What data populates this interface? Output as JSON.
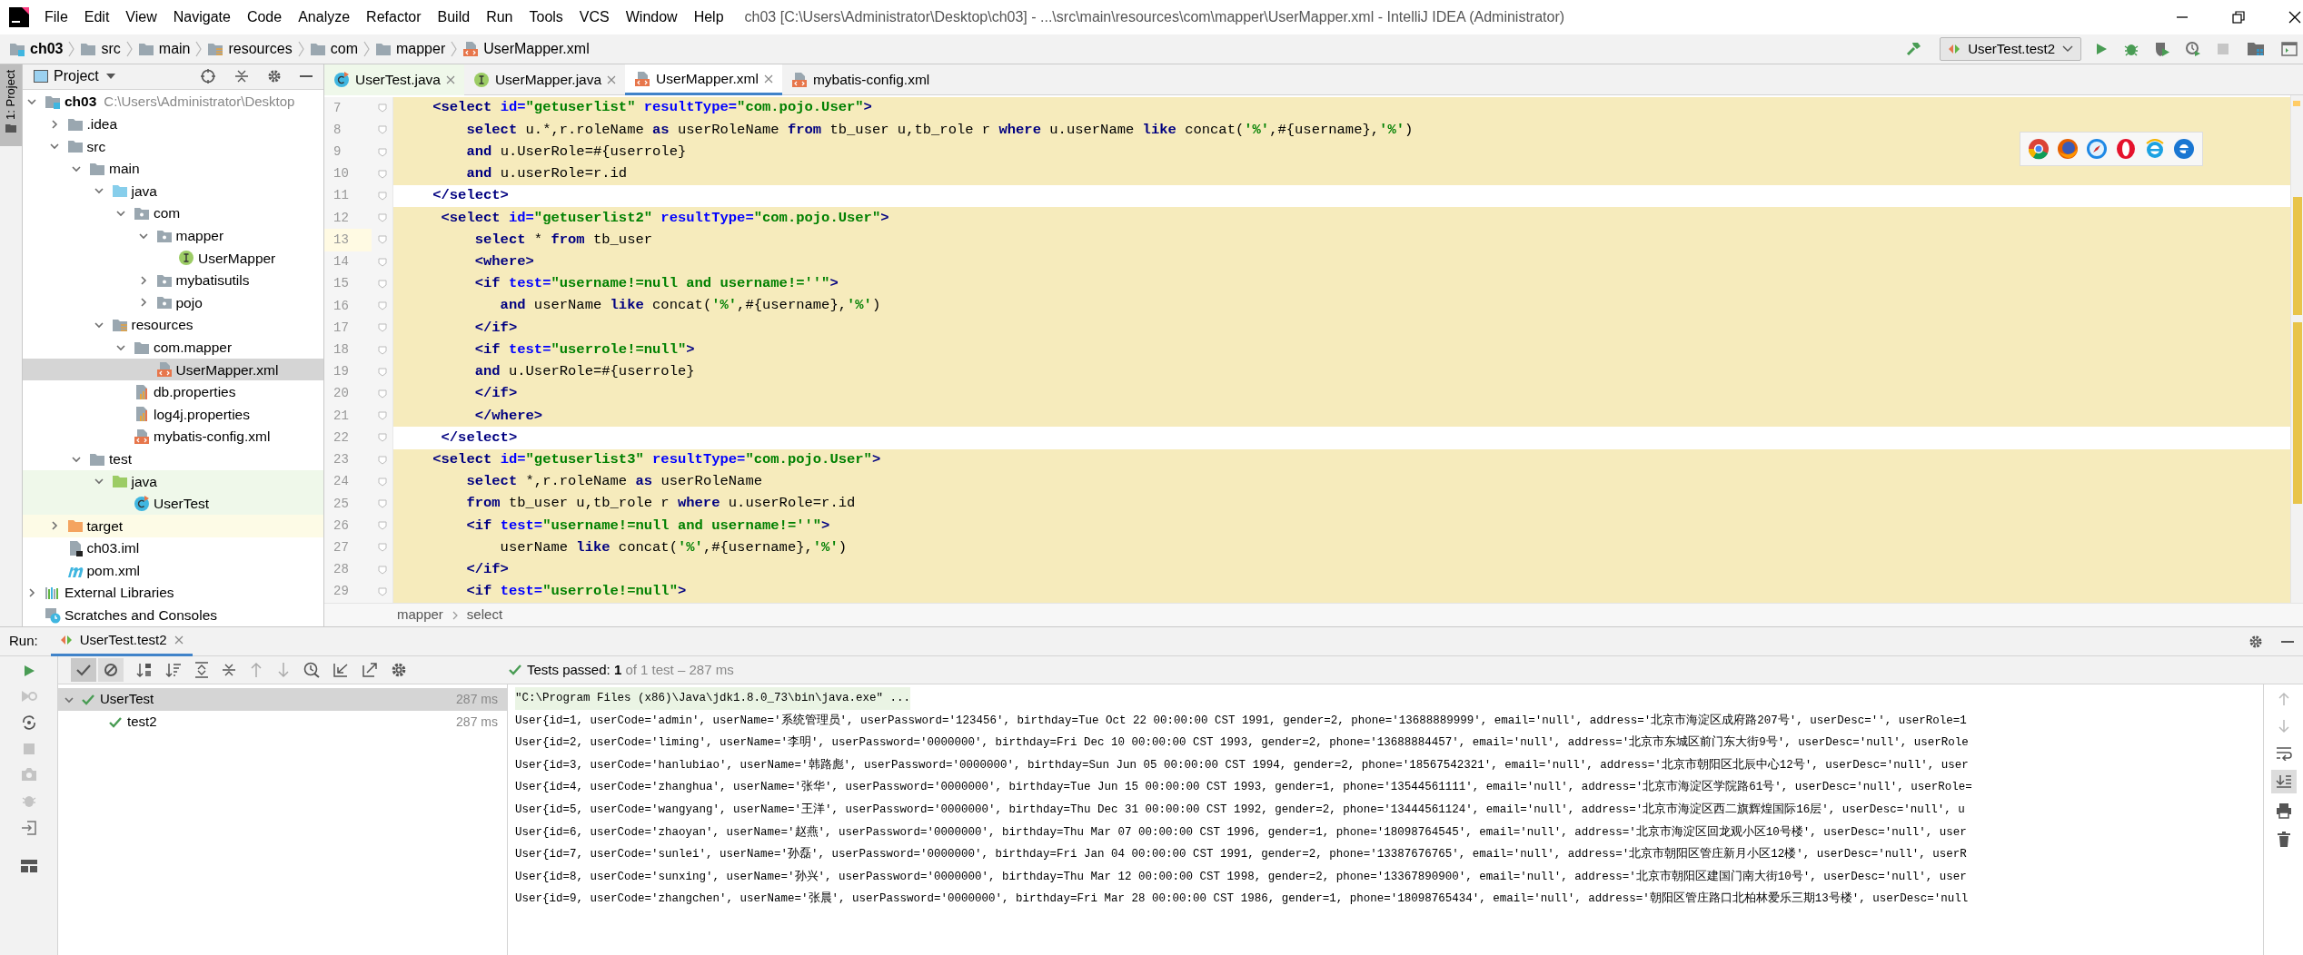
{
  "title_bar": {
    "menu": [
      "File",
      "Edit",
      "View",
      "Navigate",
      "Code",
      "Analyze",
      "Refactor",
      "Build",
      "Run",
      "Tools",
      "VCS",
      "Window",
      "Help"
    ],
    "title": "ch03 [C:\\Users\\Administrator\\Desktop\\ch03] - ...\\src\\main\\resources\\com\\mapper\\UserMapper.xml - IntelliJ IDEA (Administrator)"
  },
  "nav_bar": {
    "crumbs": [
      {
        "label": "ch03",
        "kind": "module"
      },
      {
        "label": "src",
        "kind": "folder"
      },
      {
        "label": "main",
        "kind": "folder"
      },
      {
        "label": "resources",
        "kind": "resources-folder"
      },
      {
        "label": "com",
        "kind": "folder"
      },
      {
        "label": "mapper",
        "kind": "folder"
      },
      {
        "label": "UserMapper.xml",
        "kind": "xml"
      }
    ],
    "run_config": "UserTest.test2"
  },
  "side_strip": {
    "label": "1: Project"
  },
  "project": {
    "title": "Project",
    "tree": [
      {
        "label": "ch03",
        "path_hint": "C:\\Users\\Administrator\\Desktop",
        "kind": "module",
        "expanded": true,
        "selected": false,
        "children": [
          {
            "label": ".idea",
            "kind": "folder",
            "expanded": false,
            "selected": false
          },
          {
            "label": "src",
            "kind": "folder",
            "expanded": true,
            "selected": false,
            "children": [
              {
                "label": "main",
                "kind": "folder",
                "expanded": true,
                "selected": false,
                "children": [
                  {
                    "label": "java",
                    "kind": "source-folder",
                    "expanded": true,
                    "selected": false,
                    "children": [
                      {
                        "label": "com",
                        "kind": "package",
                        "expanded": true,
                        "selected": false,
                        "children": [
                          {
                            "label": "mapper",
                            "kind": "package",
                            "expanded": true,
                            "selected": false,
                            "children": [
                              {
                                "label": "UserMapper",
                                "kind": "interface",
                                "selected": false
                              }
                            ]
                          },
                          {
                            "label": "mybatisutils",
                            "kind": "package",
                            "expanded": false,
                            "selected": false
                          },
                          {
                            "label": "pojo",
                            "kind": "package",
                            "expanded": false,
                            "selected": false
                          }
                        ]
                      }
                    ]
                  },
                  {
                    "label": "resources",
                    "kind": "resources-folder",
                    "expanded": true,
                    "selected": false,
                    "children": [
                      {
                        "label": "com.mapper",
                        "kind": "folder",
                        "expanded": true,
                        "selected": false,
                        "children": [
                          {
                            "label": "UserMapper.xml",
                            "kind": "xml",
                            "selected": true
                          }
                        ]
                      },
                      {
                        "label": "db.properties",
                        "kind": "properties",
                        "selected": false
                      },
                      {
                        "label": "log4j.properties",
                        "kind": "properties",
                        "selected": false
                      },
                      {
                        "label": "mybatis-config.xml",
                        "kind": "xml",
                        "selected": false
                      }
                    ]
                  }
                ]
              },
              {
                "label": "test",
                "kind": "folder",
                "expanded": true,
                "selected": false,
                "children": [
                  {
                    "label": "java",
                    "kind": "test-folder",
                    "expanded": true,
                    "selected": false,
                    "children": [
                      {
                        "label": "UserTest",
                        "kind": "test-class",
                        "selected": false
                      }
                    ]
                  }
                ]
              }
            ]
          },
          {
            "label": "target",
            "kind": "excluded-folder",
            "expanded": false,
            "selected": false
          },
          {
            "label": "ch03.iml",
            "kind": "iml",
            "selected": false
          },
          {
            "label": "pom.xml",
            "kind": "maven",
            "selected": false
          }
        ]
      },
      {
        "label": "External Libraries",
        "kind": "libraries",
        "expanded": false,
        "selected": false
      },
      {
        "label": "Scratches and Consoles",
        "kind": "scratches",
        "selected": false
      }
    ]
  },
  "editor": {
    "tabs": [
      {
        "label": "UserTest.java",
        "kind": "test-class",
        "selected": false,
        "closable": true
      },
      {
        "label": "UserMapper.java",
        "kind": "interface",
        "selected": false,
        "closable": true
      },
      {
        "label": "UserMapper.xml",
        "kind": "xml",
        "selected": true,
        "closable": true
      },
      {
        "label": "mybatis-config.xml",
        "kind": "xml",
        "selected": false,
        "closable": false
      }
    ],
    "lines": [
      {
        "n": "7",
        "injected": true,
        "current": false,
        "tokens": [
          {
            "kind": "tag",
            "text": "    <select "
          },
          {
            "kind": "attribute",
            "text": "id="
          },
          {
            "kind": "value",
            "text": "\"getuserlist\""
          },
          {
            "kind": "attribute",
            "text": " resultType="
          },
          {
            "kind": "value",
            "text": "\"com.pojo.User\""
          },
          {
            "kind": "tag",
            "text": ">"
          }
        ]
      },
      {
        "n": "8",
        "injected": true,
        "current": false,
        "tokens": [
          {
            "kind": "keyword",
            "text": "        select"
          },
          {
            "kind": "plain",
            "text": " u.*,r.roleName "
          },
          {
            "kind": "keyword",
            "text": "as"
          },
          {
            "kind": "plain",
            "text": " userRoleName "
          },
          {
            "kind": "keyword",
            "text": "from"
          },
          {
            "kind": "plain",
            "text": " tb_user u,tb_role r "
          },
          {
            "kind": "keyword",
            "text": "where"
          },
          {
            "kind": "plain",
            "text": " u.userName "
          },
          {
            "kind": "keyword",
            "text": "like"
          },
          {
            "kind": "plain",
            "text": " concat("
          },
          {
            "kind": "string",
            "text": "'%'"
          },
          {
            "kind": "plain",
            "text": ",#{username},"
          },
          {
            "kind": "string",
            "text": "'%'"
          },
          {
            "kind": "plain",
            "text": ")"
          }
        ]
      },
      {
        "n": "9",
        "injected": true,
        "current": false,
        "tokens": [
          {
            "kind": "keyword",
            "text": "        and"
          },
          {
            "kind": "plain",
            "text": " u.UserRole=#{userrole}"
          }
        ]
      },
      {
        "n": "10",
        "injected": true,
        "current": false,
        "tokens": [
          {
            "kind": "keyword",
            "text": "        and"
          },
          {
            "kind": "plain",
            "text": " u.userRole=r.id"
          }
        ]
      },
      {
        "n": "11",
        "injected": false,
        "current": false,
        "tokens": [
          {
            "kind": "tag",
            "text": "    </select>"
          }
        ]
      },
      {
        "n": "12",
        "injected": true,
        "current": false,
        "tokens": [
          {
            "kind": "tag",
            "text": "     <select "
          },
          {
            "kind": "attribute",
            "text": "id="
          },
          {
            "kind": "value",
            "text": "\"getuserlist2\""
          },
          {
            "kind": "attribute",
            "text": " resultType="
          },
          {
            "kind": "value",
            "text": "\"com.pojo.User\""
          },
          {
            "kind": "tag",
            "text": ">"
          }
        ]
      },
      {
        "n": "13",
        "injected": true,
        "current": true,
        "tokens": [
          {
            "kind": "keyword",
            "text": "         select"
          },
          {
            "kind": "plain",
            "text": " * "
          },
          {
            "kind": "keyword",
            "text": "from"
          },
          {
            "kind": "plain",
            "text": " tb_user"
          }
        ]
      },
      {
        "n": "14",
        "injected": true,
        "current": false,
        "tokens": [
          {
            "kind": "tag",
            "text": "         <where>"
          }
        ]
      },
      {
        "n": "15",
        "injected": true,
        "current": false,
        "tokens": [
          {
            "kind": "tag",
            "text": "         <if "
          },
          {
            "kind": "attribute",
            "text": "test="
          },
          {
            "kind": "value",
            "text": "\"username!=null and username!=''\""
          },
          {
            "kind": "tag",
            "text": ">"
          }
        ]
      },
      {
        "n": "16",
        "injected": true,
        "current": false,
        "tokens": [
          {
            "kind": "keyword",
            "text": "            and"
          },
          {
            "kind": "plain",
            "text": " userName "
          },
          {
            "kind": "keyword",
            "text": "like"
          },
          {
            "kind": "plain",
            "text": " concat("
          },
          {
            "kind": "string",
            "text": "'%'"
          },
          {
            "kind": "plain",
            "text": ",#{username},"
          },
          {
            "kind": "string",
            "text": "'%'"
          },
          {
            "kind": "plain",
            "text": ")"
          }
        ]
      },
      {
        "n": "17",
        "injected": true,
        "current": false,
        "tokens": [
          {
            "kind": "tag",
            "text": "         </if>"
          }
        ]
      },
      {
        "n": "18",
        "injected": true,
        "current": false,
        "tokens": [
          {
            "kind": "tag",
            "text": "         <if "
          },
          {
            "kind": "attribute",
            "text": "test="
          },
          {
            "kind": "value",
            "text": "\"userrole!=null\""
          },
          {
            "kind": "tag",
            "text": ">"
          }
        ]
      },
      {
        "n": "19",
        "injected": true,
        "current": false,
        "tokens": [
          {
            "kind": "keyword",
            "text": "         and"
          },
          {
            "kind": "plain",
            "text": " u.UserRole=#{userrole}"
          }
        ]
      },
      {
        "n": "20",
        "injected": true,
        "current": false,
        "tokens": [
          {
            "kind": "tag",
            "text": "         </if>"
          }
        ]
      },
      {
        "n": "21",
        "injected": true,
        "current": false,
        "tokens": [
          {
            "kind": "tag",
            "text": "         </where>"
          }
        ]
      },
      {
        "n": "22",
        "injected": false,
        "current": false,
        "tokens": [
          {
            "kind": "tag",
            "text": "     </select>"
          }
        ]
      },
      {
        "n": "23",
        "injected": true,
        "current": false,
        "tokens": [
          {
            "kind": "tag",
            "text": "    <select "
          },
          {
            "kind": "attribute",
            "text": "id="
          },
          {
            "kind": "value",
            "text": "\"getuserlist3\""
          },
          {
            "kind": "attribute",
            "text": " resultType="
          },
          {
            "kind": "value",
            "text": "\"com.pojo.User\""
          },
          {
            "kind": "tag",
            "text": ">"
          }
        ]
      },
      {
        "n": "24",
        "injected": true,
        "current": false,
        "tokens": [
          {
            "kind": "keyword",
            "text": "        select"
          },
          {
            "kind": "plain",
            "text": " *,r.roleName "
          },
          {
            "kind": "keyword",
            "text": "as"
          },
          {
            "kind": "plain",
            "text": " userRoleName"
          }
        ]
      },
      {
        "n": "25",
        "injected": true,
        "current": false,
        "tokens": [
          {
            "kind": "keyword",
            "text": "        from"
          },
          {
            "kind": "plain",
            "text": " tb_user u,tb_role r "
          },
          {
            "kind": "keyword",
            "text": "where"
          },
          {
            "kind": "plain",
            "text": " u.userRole=r.id"
          }
        ]
      },
      {
        "n": "26",
        "injected": true,
        "current": false,
        "tokens": [
          {
            "kind": "tag",
            "text": "        <if "
          },
          {
            "kind": "attribute",
            "text": "test="
          },
          {
            "kind": "value",
            "text": "\"username!=null and username!=''\""
          },
          {
            "kind": "tag",
            "text": ">"
          }
        ]
      },
      {
        "n": "27",
        "injected": true,
        "current": false,
        "tokens": [
          {
            "kind": "plain",
            "text": "            userName "
          },
          {
            "kind": "keyword",
            "text": "like"
          },
          {
            "kind": "plain",
            "text": " concat("
          },
          {
            "kind": "string",
            "text": "'%'"
          },
          {
            "kind": "plain",
            "text": ",#{username},"
          },
          {
            "kind": "string",
            "text": "'%'"
          },
          {
            "kind": "plain",
            "text": ")"
          }
        ]
      },
      {
        "n": "28",
        "injected": true,
        "current": false,
        "tokens": [
          {
            "kind": "tag",
            "text": "        </if>"
          }
        ]
      },
      {
        "n": "29",
        "injected": true,
        "current": false,
        "tokens": [
          {
            "kind": "tag",
            "text": "        <if "
          },
          {
            "kind": "attribute",
            "text": "test="
          },
          {
            "kind": "value",
            "text": "\"userrole!=null\""
          },
          {
            "kind": "tag",
            "text": ">"
          }
        ]
      }
    ],
    "breadcrumbs": [
      "mapper",
      "select"
    ]
  },
  "run": {
    "label": "Run:",
    "tab": "UserTest.test2",
    "status": {
      "label": "Tests passed:",
      "count": "1",
      "detail": "of 1 test – 287 ms"
    },
    "tests": [
      {
        "label": "UserTest",
        "time": "287 ms",
        "expanded": true,
        "selected": true,
        "children": [
          {
            "label": "test2",
            "time": "287 ms",
            "selected": false
          }
        ]
      }
    ],
    "console": [
      {
        "kind": "command",
        "text": "\"C:\\Program Files (x86)\\Java\\jdk1.8.0_73\\bin\\java.exe\" ..."
      },
      {
        "kind": "output",
        "text": "User{id=1, userCode='admin', userName='系统管理员', userPassword='123456', birthday=Tue Oct 22 00:00:00 CST 1991, gender=2, phone='13688889999', email='null', address='北京市海淀区成府路207号', userDesc='', userRole=1"
      },
      {
        "kind": "output",
        "text": "User{id=2, userCode='liming', userName='李明', userPassword='0000000', birthday=Fri Dec 10 00:00:00 CST 1993, gender=2, phone='13688884457', email='null', address='北京市东城区前门东大街9号', userDesc='null', userRole"
      },
      {
        "kind": "output",
        "text": "User{id=3, userCode='hanlubiao', userName='韩路彪', userPassword='0000000', birthday=Sun Jun 05 00:00:00 CST 1994, gender=2, phone='18567542321', email='null', address='北京市朝阳区北辰中心12号', userDesc='null', user"
      },
      {
        "kind": "output",
        "text": "User{id=4, userCode='zhanghua', userName='张华', userPassword='0000000', birthday=Tue Jun 15 00:00:00 CST 1993, gender=1, phone='13544561111', email='null', address='北京市海淀区学院路61号', userDesc='null', userRole="
      },
      {
        "kind": "output",
        "text": "User{id=5, userCode='wangyang', userName='王洋', userPassword='0000000', birthday=Thu Dec 31 00:00:00 CST 1992, gender=2, phone='13444561124', email='null', address='北京市海淀区西二旗辉煌国际16层', userDesc='null', u"
      },
      {
        "kind": "output",
        "text": "User{id=6, userCode='zhaoyan', userName='赵燕', userPassword='0000000', birthday=Thu Mar 07 00:00:00 CST 1996, gender=1, phone='18098764545', email='null', address='北京市海淀区回龙观小区10号楼', userDesc='null', user"
      },
      {
        "kind": "output",
        "text": "User{id=7, userCode='sunlei', userName='孙磊', userPassword='0000000', birthday=Fri Jan 04 00:00:00 CST 1991, gender=2, phone='13387676765', email='null', address='北京市朝阳区管庄新月小区12楼', userDesc='null', userR"
      },
      {
        "kind": "output",
        "text": "User{id=8, userCode='sunxing', userName='孙兴', userPassword='0000000', birthday=Thu Mar 12 00:00:00 CST 1998, gender=2, phone='13367890900', email='null', address='北京市朝阳区建国门南大街10号', userDesc='null', user"
      },
      {
        "kind": "output",
        "text": "User{id=9, userCode='zhangchen', userName='张晨', userPassword='0000000', birthday=Fri Mar 28 00:00:00 CST 1986, gender=1, phone='18098765434', email='null', address='朝阳区管庄路口北柏林爱乐三期13号楼', userDesc='null"
      }
    ]
  }
}
